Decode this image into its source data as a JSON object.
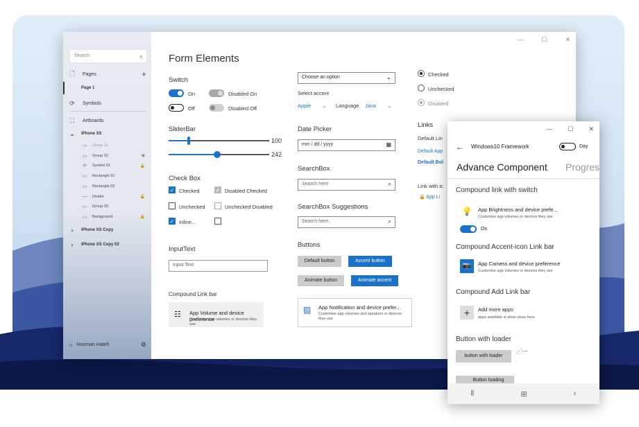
{
  "colors": {
    "accent": "#1a73c8",
    "backdrop_top": "#e0edf8",
    "mountain_dark": "#101f50"
  },
  "main": {
    "sidebar": {
      "search_placeholder": "Search",
      "pages_label": "Pages",
      "page1": "Page 1",
      "symbols": "Symbols",
      "artboards": "Artboards",
      "iphone": "iPhone XS",
      "items": [
        "Group 01",
        "Group 02",
        "Symbol 01",
        "Rectangle 01",
        "Rectangle 02",
        "Divider",
        "Group 03",
        "Background"
      ],
      "copy1": "iPhone XS Copy",
      "copy2": "iPhone XS Copy 02",
      "user": "Hooman Hatefi"
    },
    "title": "Form Elements",
    "switch": {
      "label": "Switch",
      "on": "On",
      "off": "Off",
      "disabled_on": "Disabled On",
      "disabled_off": "Disabled Off"
    },
    "slider": {
      "label": "SliderBar",
      "value1": "100",
      "value2": "242",
      "level1": 0.2,
      "level2": 0.48
    },
    "checkbox": {
      "label": "Check Box",
      "checked": "Checked",
      "disabled_checked": "Disabled Checked",
      "unchecked": "Unchecked",
      "unchecked_disabled": "Unchecked Disabled",
      "inline": "Inline..."
    },
    "inputtext": {
      "label": "InputText",
      "placeholder": "Input Text"
    },
    "compound_link": {
      "label": "Compound Link bar",
      "title": "App Volume and device preference",
      "sub": "Customise app volumes or devices they use"
    },
    "dropdown": {
      "value": "Choose an option"
    },
    "accent": {
      "label": "Select accent",
      "apple": "Apple",
      "language": "Language",
      "java": "Java"
    },
    "datepicker": {
      "label": "Date Picker",
      "value": "mm / dd / yyyy"
    },
    "searchbox": {
      "label": "SearchBox",
      "placeholder": "Search here"
    },
    "suggest": {
      "label": "SearchBox Suggestions",
      "placeholder": "Search here.."
    },
    "buttons": {
      "label": "Buttons",
      "default": "Default button",
      "accent": "Accent button",
      "animate": "Animate button",
      "animate_accent": "Animate accent"
    },
    "notification": {
      "title": "App Notification and device prefer...",
      "sub": "Customise app volumes and speakers or devices they use"
    },
    "radio": {
      "checked": "Checked",
      "unchecked": "Unchecked",
      "disabled": "Disabled"
    },
    "links": {
      "label": "Links",
      "default_lin": "Default Lin",
      "default_app": "Default App",
      "default_bol": "Default Bol",
      "link_with_icon": "Link with ic",
      "app_li": "App Li"
    }
  },
  "w2": {
    "title": "Windows10 Framework",
    "day": "Day",
    "tab_active": "Advance Component",
    "tab_next": "Progres",
    "sec1": "Compound link with switch",
    "bright_title": "App Brightness and device prefe...",
    "bright_sub": "Customise app volumes or devices they use",
    "on": "On",
    "sec2": "Compound Accent-icon Link bar",
    "cam_title": "App Camera and device preference",
    "cam_sub": "Customise app volumes or devices they use",
    "sec3": "Compound Add Link bar",
    "add_title": "Add more apps",
    "add_sub": "apps available in store show here",
    "sec4": "Button with loader",
    "loader_btn": "button with loader",
    "loading_btn": "Button loading"
  }
}
